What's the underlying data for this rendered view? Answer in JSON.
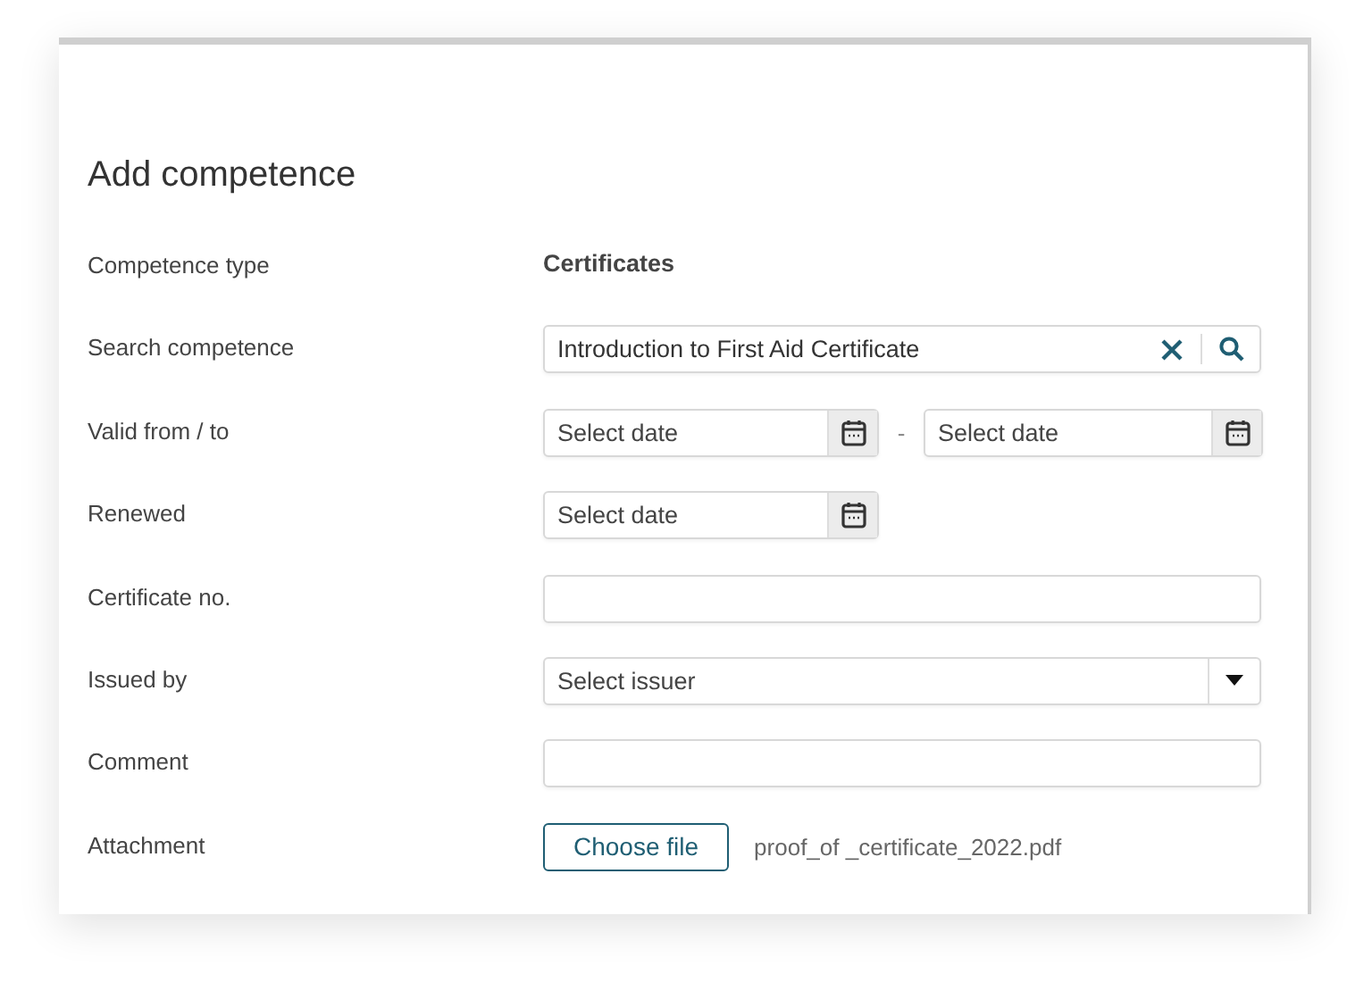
{
  "dialog": {
    "title": "Add competence",
    "fields": [
      {
        "kind": "text",
        "label": "Competence type",
        "value": "Certificates"
      },
      {
        "kind": "search",
        "label": "Search competence",
        "value": "Introduction to First Aid Certificate"
      },
      {
        "kind": "date_range",
        "label": "Valid from / to",
        "from_placeholder": "Select date",
        "separator": "-",
        "to_placeholder": "Select date"
      },
      {
        "kind": "date",
        "label": "Renewed",
        "placeholder": "Select date"
      },
      {
        "kind": "input",
        "label": "Certificate no."
      },
      {
        "kind": "select",
        "label": "Issued by",
        "placeholder": "Select issuer"
      },
      {
        "kind": "input",
        "label": "Comment"
      },
      {
        "kind": "file",
        "label": "Attachment",
        "button": "Choose file",
        "file_name": "proof_of _certificate_2022.pdf"
      }
    ]
  }
}
